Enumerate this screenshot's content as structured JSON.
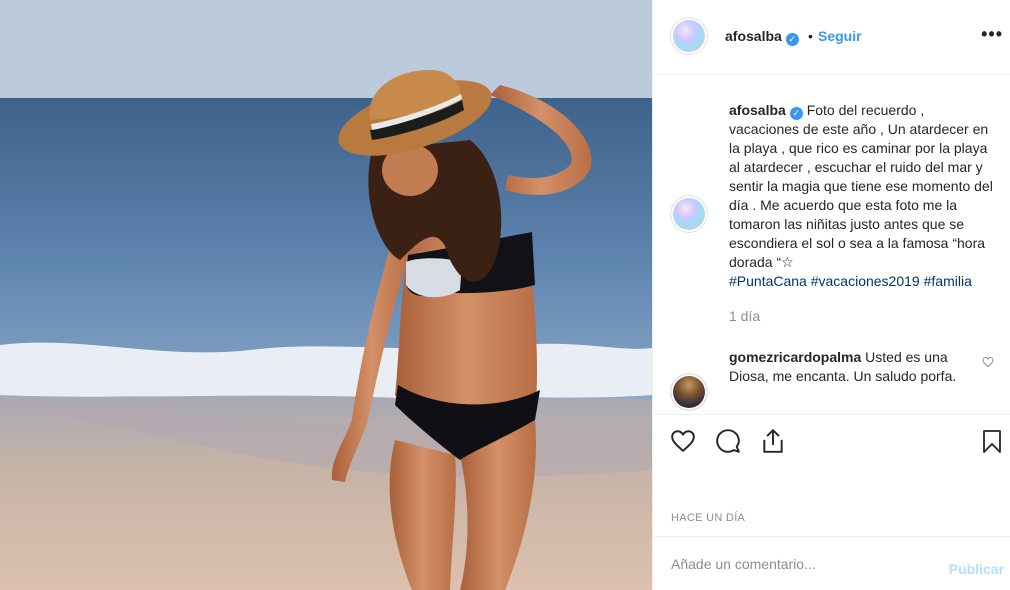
{
  "post": {
    "username": "afosalba",
    "follow_label": "Seguir",
    "dot": "•",
    "more_icon": "more-options-icon",
    "verified_icon": "verified-badge-icon"
  },
  "caption": {
    "username": "afosalba",
    "text": "Foto del recuerdo , vacaciones de este año , Un atardecer en la playa , que rico es caminar por la playa al atardecer , escuchar el ruido del mar y sentir la magia que tiene ese momento del día . Me acuerdo que esta foto me la tomaron las niñitas justo antes que se escondiera el sol o sea a la famosa “hora dorada “☆",
    "hashtags": [
      "#PuntaCana",
      "#vacaciones2019",
      "#familia"
    ],
    "time": "1 día"
  },
  "comment": {
    "username": "gomezricardopalma",
    "text": "Usted es una Diosa, me encanta. Un saludo porfa."
  },
  "actions": {
    "icons": [
      "heart-icon",
      "comment-icon",
      "share-icon",
      "bookmark-icon"
    ],
    "timestamp": "HACE UN DÍA"
  },
  "comment_box": {
    "placeholder": "Añade un comentario...",
    "publish_label": "Publicar"
  },
  "colors": {
    "accent": "#3897f0",
    "hashtag": "#003569",
    "muted": "#8e8e8e",
    "publish_disabled": "#b2dffc"
  }
}
